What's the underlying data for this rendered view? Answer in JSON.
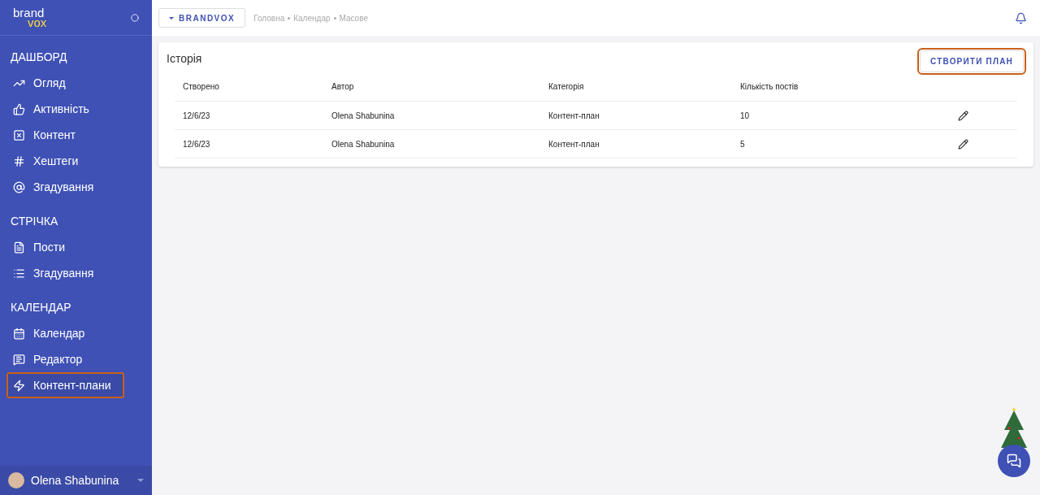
{
  "logo": {
    "top": "brand",
    "bottom": "vox"
  },
  "sidebar": {
    "sections": [
      {
        "title": "ДАШБОРД",
        "items": [
          {
            "label": "Огляд",
            "selected": false
          },
          {
            "label": "Активність",
            "selected": false
          },
          {
            "label": "Контент",
            "selected": false
          },
          {
            "label": "Хештеги",
            "selected": false
          },
          {
            "label": "Згадування",
            "selected": false
          }
        ]
      },
      {
        "title": "СТРІЧКА",
        "items": [
          {
            "label": "Пости",
            "selected": false
          },
          {
            "label": "Згадування",
            "selected": false
          }
        ]
      },
      {
        "title": "КАЛЕНДАР",
        "items": [
          {
            "label": "Календар",
            "selected": false
          },
          {
            "label": "Редактор",
            "selected": false
          },
          {
            "label": "Контент-плани",
            "selected": true
          }
        ]
      }
    ],
    "user": "Olena Shabunina"
  },
  "topbar": {
    "workspace": "BRANDVOX",
    "breadcrumbs": [
      "Головна",
      "Календар",
      "Масове"
    ]
  },
  "card": {
    "title": "Історія",
    "action": "СТВОРИТИ ПЛАН",
    "columns": [
      "Створено",
      "Автор",
      "Категорія",
      "Кількість постів"
    ],
    "rows": [
      {
        "cells": [
          "12/6/23",
          "Olena Shabunina",
          "Контент-план",
          "10"
        ]
      },
      {
        "cells": [
          "12/6/23",
          "Olena Shabunina",
          "Контент-план",
          "5"
        ]
      }
    ]
  }
}
